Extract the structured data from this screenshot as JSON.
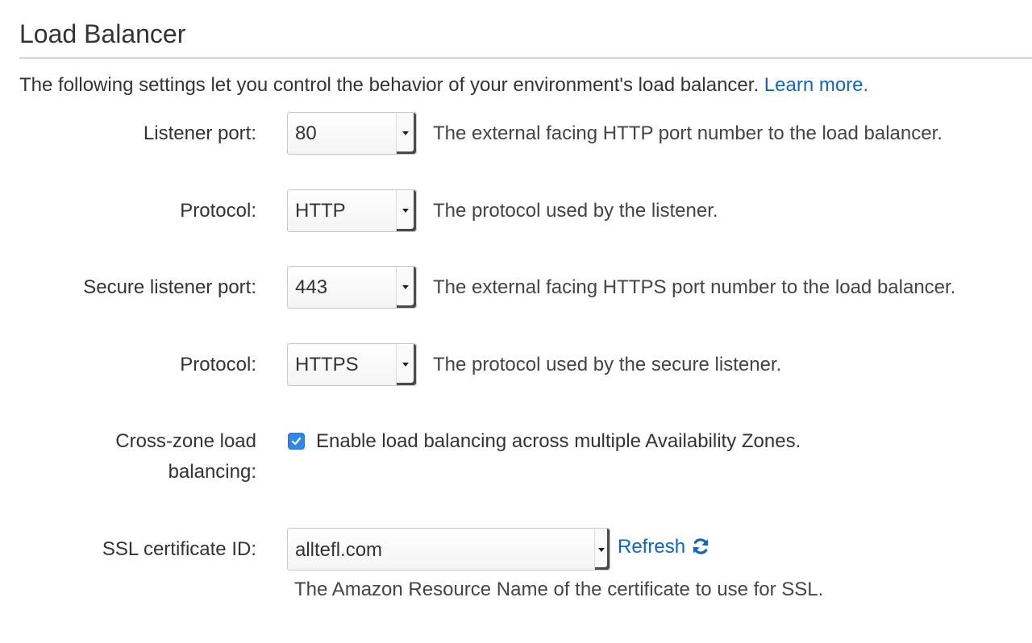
{
  "section": {
    "title": "Load Balancer",
    "intro_text": "The following settings let you control the behavior of your environment's load balancer.",
    "learn_more_label": "Learn more."
  },
  "fields": {
    "listener_port": {
      "label": "Listener port:",
      "value": "80",
      "description": "The external facing HTTP port number to the load balancer."
    },
    "protocol": {
      "label": "Protocol:",
      "value": "HTTP",
      "description": "The protocol used by the listener."
    },
    "secure_listener_port": {
      "label": "Secure listener port:",
      "value": "443",
      "description": "The external facing HTTPS port number to the load balancer."
    },
    "secure_protocol": {
      "label": "Protocol:",
      "value": "HTTPS",
      "description": "The protocol used by the secure listener."
    },
    "cross_zone": {
      "label": "Cross-zone load balancing:",
      "checked": true,
      "checkbox_label": "Enable load balancing across multiple Availability Zones."
    },
    "ssl_certificate": {
      "label": "SSL certificate ID:",
      "value": "alltefl.com",
      "refresh_label": "Refresh",
      "help_text": "The Amazon Resource Name of the certificate to use for SSL."
    }
  },
  "colors": {
    "link": "#1166bb",
    "checkbox": "#2f87e6",
    "text": "#333333"
  },
  "icons": {
    "dropdown": "caret-down-icon",
    "checkbox": "checkmark-icon",
    "refresh": "refresh-icon"
  }
}
